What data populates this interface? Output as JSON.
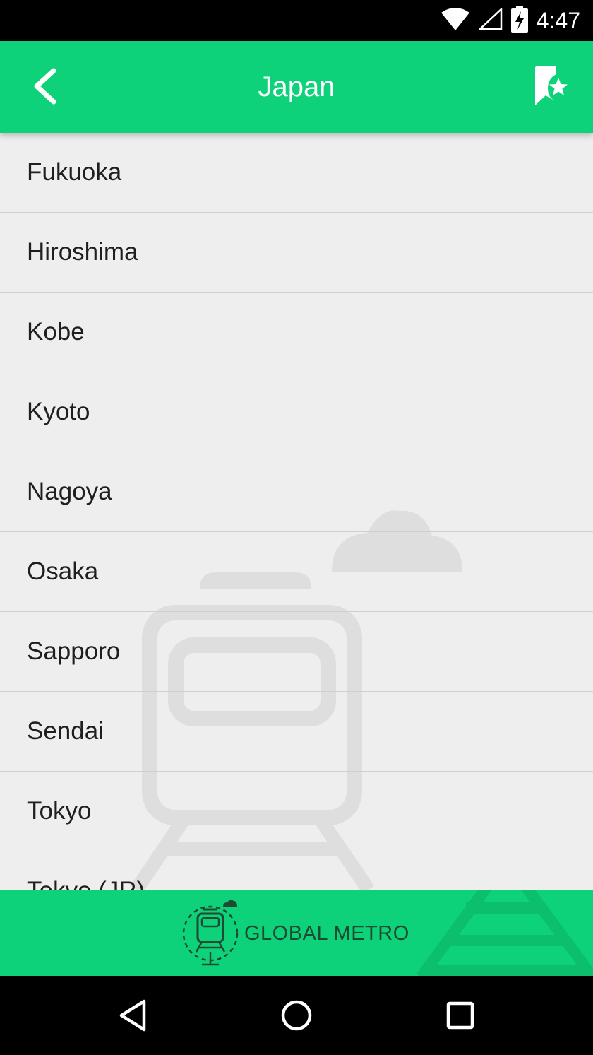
{
  "status_bar": {
    "time": "4:47",
    "icons": [
      "wifi-icon",
      "cell-signal-icon",
      "battery-charging-icon"
    ]
  },
  "app_bar": {
    "title": "Japan",
    "back_icon": "chevron-left-icon",
    "favorites_icon": "bookmark-star-icon",
    "color": "#0ed27a"
  },
  "cities": [
    {
      "name": "Fukuoka"
    },
    {
      "name": "Hiroshima"
    },
    {
      "name": "Kobe"
    },
    {
      "name": "Kyoto"
    },
    {
      "name": "Nagoya"
    },
    {
      "name": "Osaka"
    },
    {
      "name": "Sapporo"
    },
    {
      "name": "Sendai"
    },
    {
      "name": "Tokyo"
    },
    {
      "name": "Tokyo (JR)"
    }
  ],
  "footer": {
    "brand": "GLOBAL METRO",
    "logo_icon": "train-logo-icon"
  },
  "nav_bar": {
    "icons": [
      "back-triangle-icon",
      "home-circle-icon",
      "recents-square-icon"
    ]
  }
}
